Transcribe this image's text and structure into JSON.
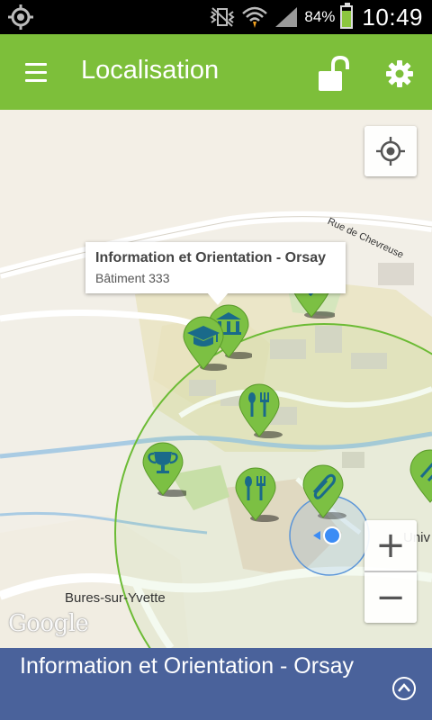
{
  "status_bar": {
    "battery_percent": "84%",
    "battery_level": 0.84,
    "time": "10:49",
    "icons": [
      "gps-icon",
      "vibrate-icon",
      "wifi-icon",
      "signal-icon",
      "battery-icon"
    ]
  },
  "app_bar": {
    "title": "Localisation",
    "menu_icon": "menu-icon",
    "lock_icon": "unlock-icon",
    "settings_icon": "gear-icon"
  },
  "map": {
    "road_label": "Rue de Chevreuse",
    "town_label": "Bures-sur-Yvette",
    "partial_label": "Univ",
    "attribution": "Google",
    "info_window": {
      "title": "Information et Orientation - Orsay",
      "subtitle": "Bâtiment 333"
    },
    "controls": {
      "locate_icon": "my-location-icon",
      "zoom_in": "+",
      "zoom_out": "−"
    },
    "markers": [
      {
        "name": "education-marker",
        "icon": "graduation-cap-icon"
      },
      {
        "name": "building-marker",
        "icon": "building-icon"
      },
      {
        "name": "restaurant-marker",
        "icon": "fork-knife-icon"
      },
      {
        "name": "restaurant-marker",
        "icon": "fork-knife-icon"
      },
      {
        "name": "trophy-marker",
        "icon": "trophy-icon"
      },
      {
        "name": "paperclip-marker",
        "icon": "paperclip-icon"
      },
      {
        "name": "paperclip-marker",
        "icon": "paperclip-icon"
      },
      {
        "name": "paperclip-marker",
        "icon": "paperclip-icon"
      }
    ],
    "colors": {
      "marker_green": "#7cc043",
      "marker_icon": "#1a6a8a",
      "accuracy_circle": "#5cb82f",
      "location_dot": "#3b8cf5"
    }
  },
  "bottom_bar": {
    "title": "Information et Orientation - Orsay",
    "expand_icon": "chevron-up-circle-icon"
  },
  "theme": {
    "app_bar_color": "#7dbf3a",
    "bottom_bar_color": "#4a629b"
  }
}
